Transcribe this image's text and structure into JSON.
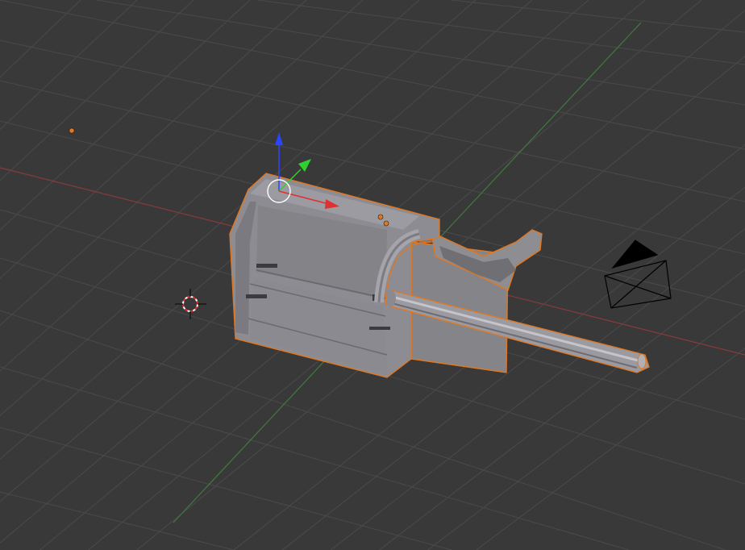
{
  "viewport": {
    "background_color": "#393939",
    "grid_color": "#4a4a4a",
    "x_axis_color": "#8a3a3a",
    "y_axis_color": "#3f7a3f",
    "selection_outline_color": "#e2771f",
    "gizmo_x_color": "#e03030",
    "gizmo_y_color": "#2fd02f",
    "gizmo_z_color": "#2a45ff",
    "mesh_color": "#8b8b90"
  },
  "objects": {
    "selected_mesh": "mechanical-part-mesh",
    "camera": "camera",
    "lamp": "lamp",
    "cursor_3d": "3d-cursor"
  },
  "icons": {
    "transform_gizmo": "translate-gizmo-icon",
    "camera": "camera-icon",
    "cursor": "3d-cursor-icon",
    "lamp": "lamp-icon"
  }
}
